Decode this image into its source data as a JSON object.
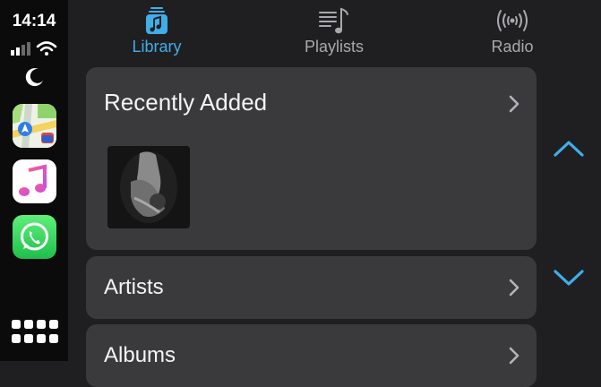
{
  "status_bar": {
    "time": "14:14"
  },
  "sidebar": {
    "apps": [
      {
        "name": "maps-icon"
      },
      {
        "name": "music-icon"
      },
      {
        "name": "whatsapp-icon"
      }
    ]
  },
  "tabs": [
    {
      "label": "Library",
      "icon": "music-note-stack-icon",
      "active": true
    },
    {
      "label": "Playlists",
      "icon": "playlist-icon",
      "active": false
    },
    {
      "label": "Radio",
      "icon": "radio-broadcast-icon",
      "active": false
    }
  ],
  "list": {
    "recently_added": "Recently Added",
    "artists": "Artists",
    "albums": "Albums"
  },
  "colors": {
    "accent": "#3faee9",
    "card": "#3a3a3d",
    "background": "#1f1f21",
    "sidebar": "#0b0b0c"
  }
}
